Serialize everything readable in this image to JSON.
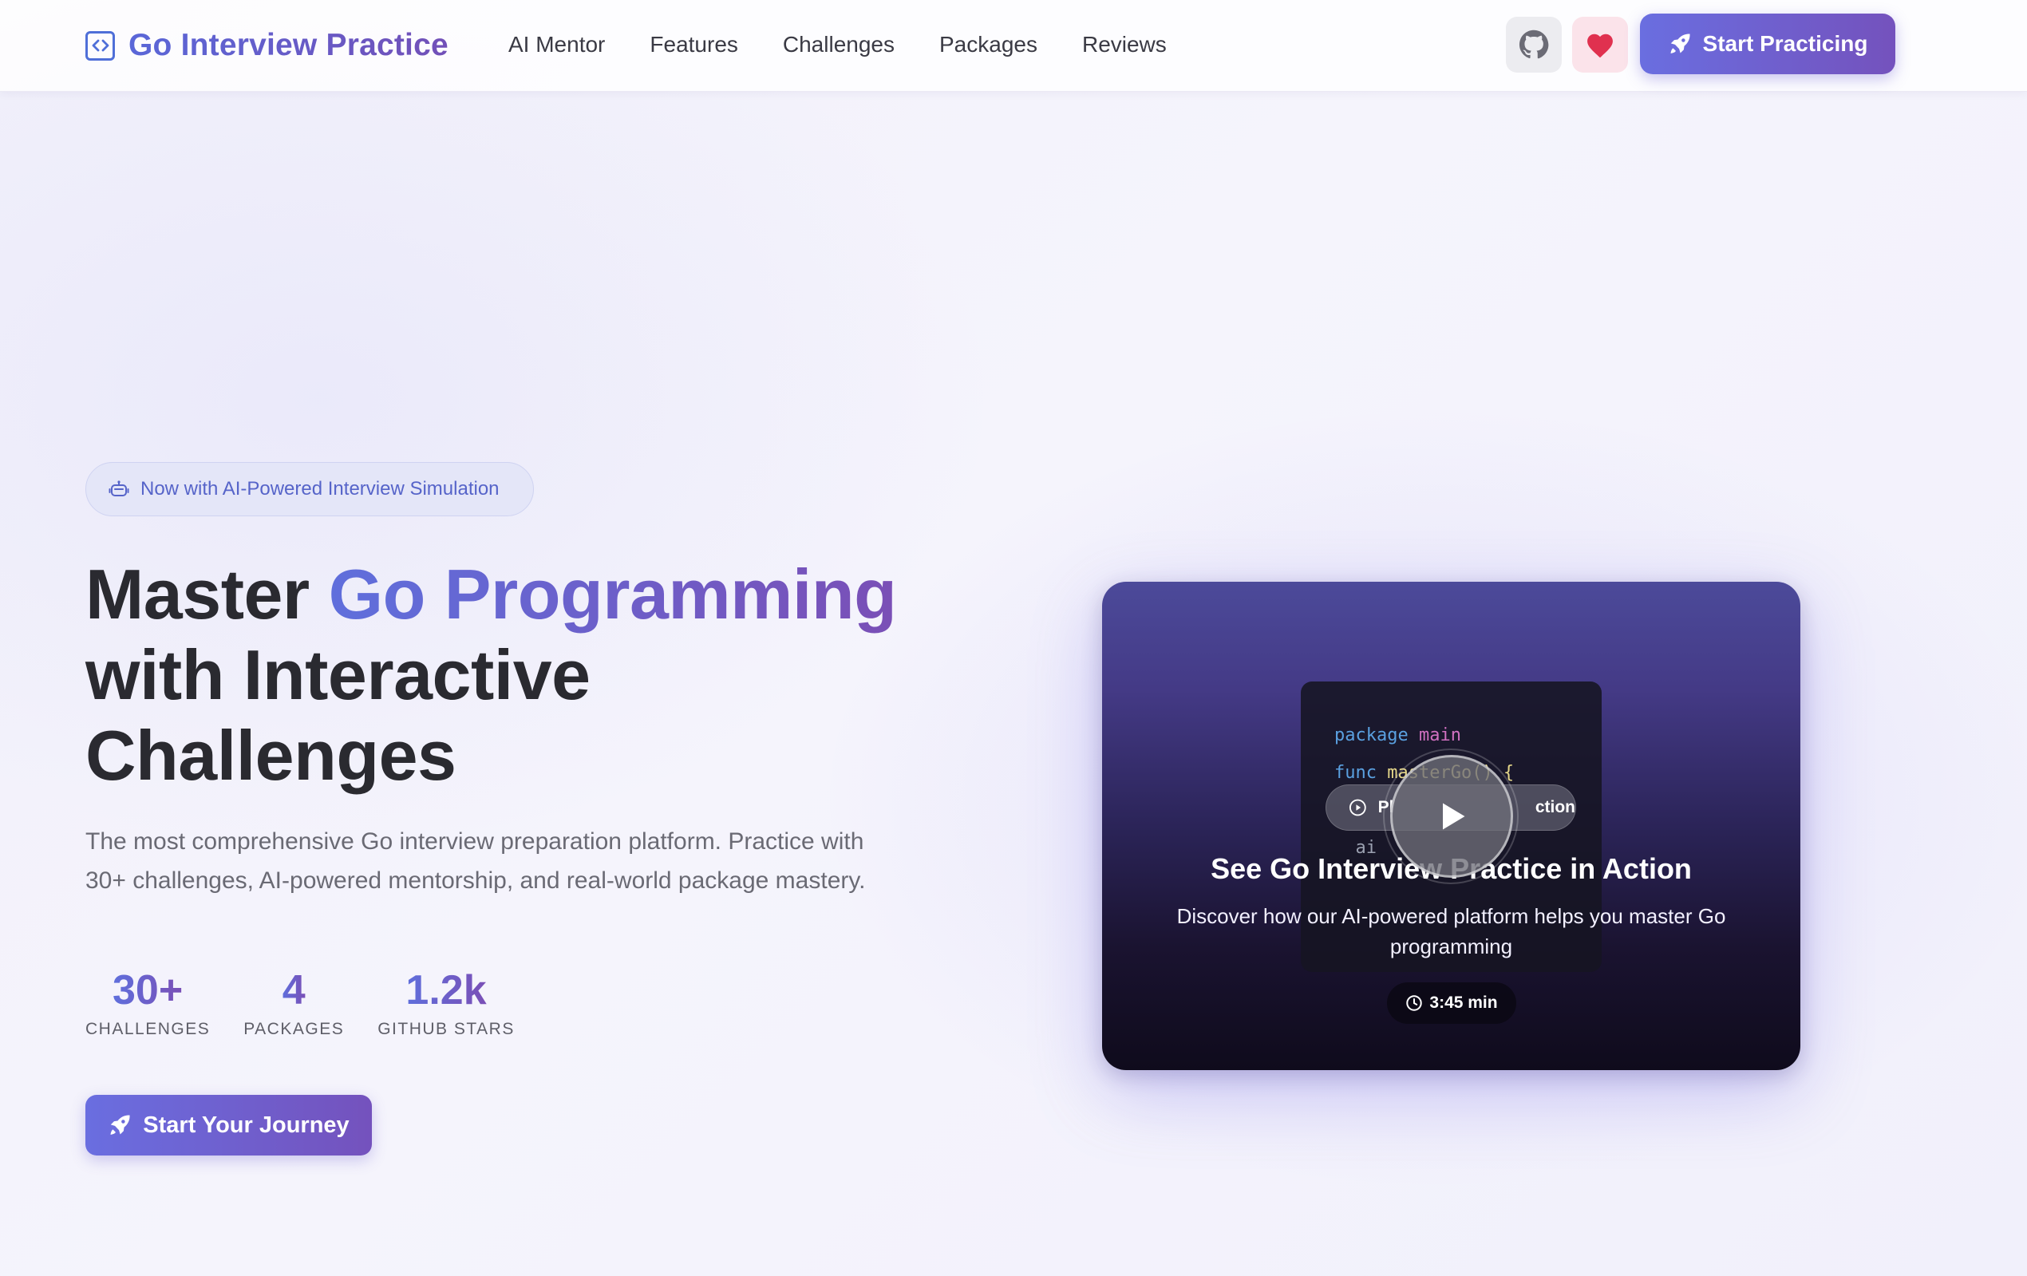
{
  "nav": {
    "brand": "Go Interview Practice",
    "links": [
      "AI Mentor",
      "Features",
      "Challenges",
      "Packages",
      "Reviews"
    ],
    "cta": "Start Practicing"
  },
  "hero": {
    "badge": "Now with AI-Powered Interview Simulation",
    "title_prefix": "Master ",
    "title_accent": "Go Programming",
    "title_line2": "with Interactive",
    "title_line3": "Challenges",
    "description": "The most comprehensive Go interview preparation platform. Practice with 30+ challenges, AI-powered mentorship, and real-world package mastery.",
    "stats": [
      {
        "value": "30+",
        "label": "CHALLENGES"
      },
      {
        "value": "4",
        "label": "PACKAGES"
      },
      {
        "value": "1.2k",
        "label": "GITHUB STARS"
      }
    ],
    "cta": "Start Your Journey"
  },
  "video": {
    "code": {
      "line1_kw": "package",
      "line1_name": "main",
      "line2_kw": "func",
      "line2_name": "masterGo() {",
      "line3": "ai"
    },
    "preview_start": "Pl",
    "preview_end": "ction",
    "title": "See Go Interview Practice in Action",
    "description": "Discover how our AI-powered platform helps you master Go programming",
    "duration": "3:45 min"
  },
  "colors": {
    "accent_start": "#5a67d8",
    "accent_end": "#7452bd",
    "heart": "#e0314f"
  }
}
